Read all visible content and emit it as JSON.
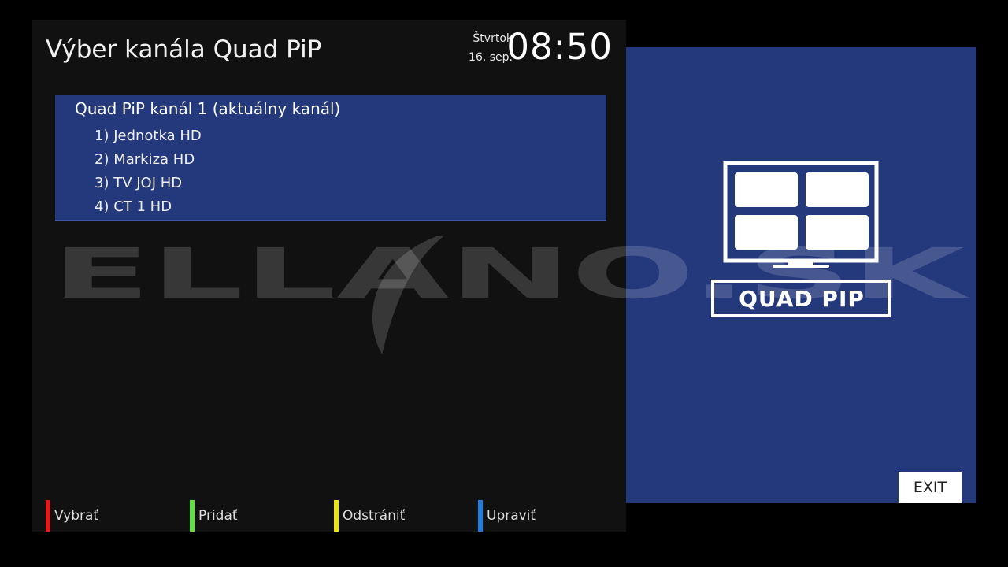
{
  "header": {
    "title": "Výber kanála Quad PiP",
    "weekday": "Štvrtok",
    "date": "16. sep.",
    "time": "08:50"
  },
  "channel_group": {
    "title": "Quad PiP kanál 1 (aktuálny kanál)",
    "channels": [
      "1) Jednotka HD",
      "2) Markiza HD",
      "3) TV JOJ HD",
      "4) CT 1 HD"
    ]
  },
  "watermark": {
    "text": "ELLANO.SK"
  },
  "footer": {
    "buttons": [
      {
        "label": "Vybrať",
        "color": "#e01b1b"
      },
      {
        "label": "Pridať",
        "color": "#5fe23a"
      },
      {
        "label": "Odstrániť",
        "color": "#e8e01c"
      },
      {
        "label": "Upraviť",
        "color": "#1f7fe0"
      }
    ]
  },
  "side_panel": {
    "logo_text": "QUAD PIP",
    "exit_label": "EXIT"
  },
  "colors": {
    "panel_background": "#111111",
    "accent_blue": "#24387c"
  }
}
